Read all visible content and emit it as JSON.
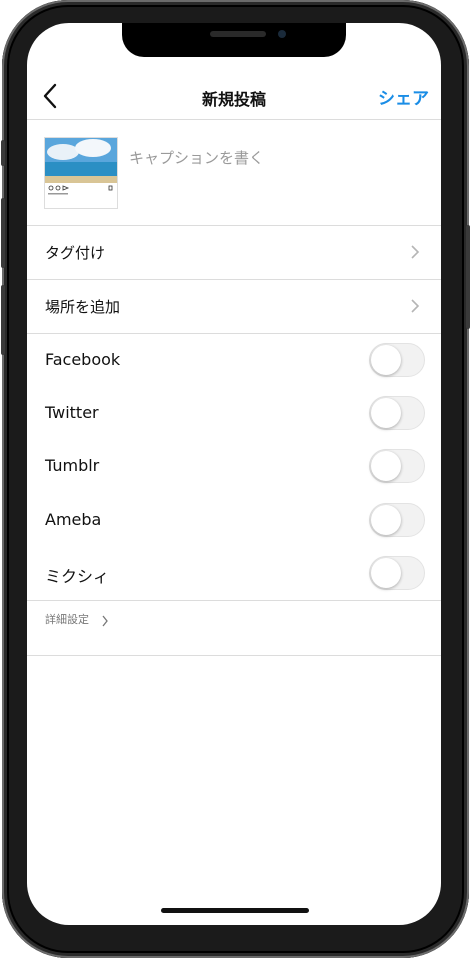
{
  "header": {
    "back_icon": "chevron-left-icon",
    "title": "新規投稿",
    "share_label": "シェア",
    "share_color": "#1a8de6"
  },
  "post": {
    "caption_placeholder": "キャプションを書く"
  },
  "rows": [
    {
      "label": "タグ付け",
      "icon": "chevron-right-icon"
    },
    {
      "label": "場所を追加",
      "icon": "chevron-right-icon"
    }
  ],
  "share_targets": [
    {
      "label": "Facebook",
      "on": false
    },
    {
      "label": "Twitter",
      "on": false
    },
    {
      "label": "Tumblr",
      "on": false
    },
    {
      "label": "Ameba",
      "on": false
    },
    {
      "label": "ミクシィ",
      "on": false
    }
  ],
  "advanced": {
    "label": "詳細設定",
    "icon": "chevron-right-icon"
  }
}
